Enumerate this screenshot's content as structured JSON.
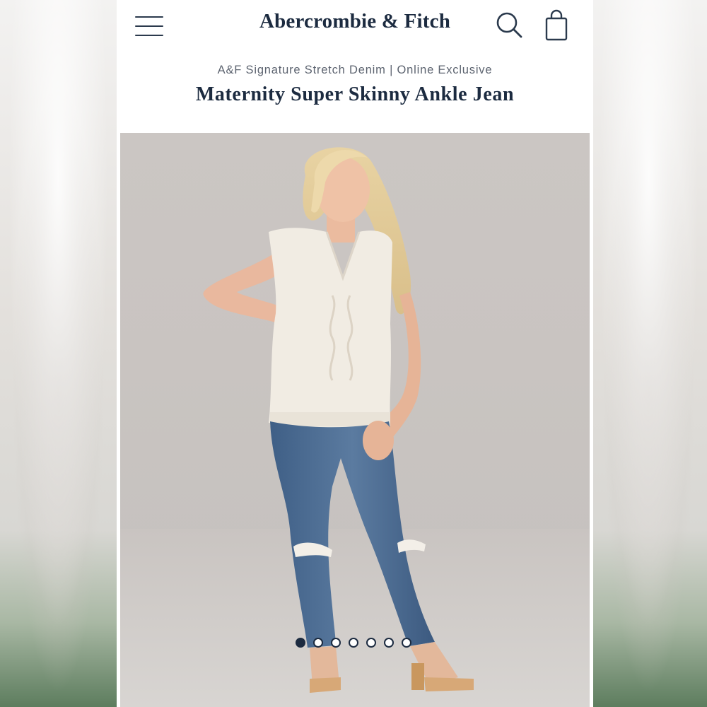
{
  "header": {
    "brand": "Abercrombie & Fitch",
    "menu_icon": "hamburger-menu-icon",
    "search_icon": "search-icon",
    "bag_icon": "shopping-bag-icon"
  },
  "product": {
    "collection": "A&F Signature Stretch Denim | Online Exclusive",
    "title": "Maternity Super Skinny Ankle Jean"
  },
  "gallery": {
    "image_count": 7,
    "active_index": 0
  },
  "colors": {
    "brand_navy": "#1c2b40",
    "photo_bg": "#c9c4c1",
    "denim": "#4f6f95"
  }
}
